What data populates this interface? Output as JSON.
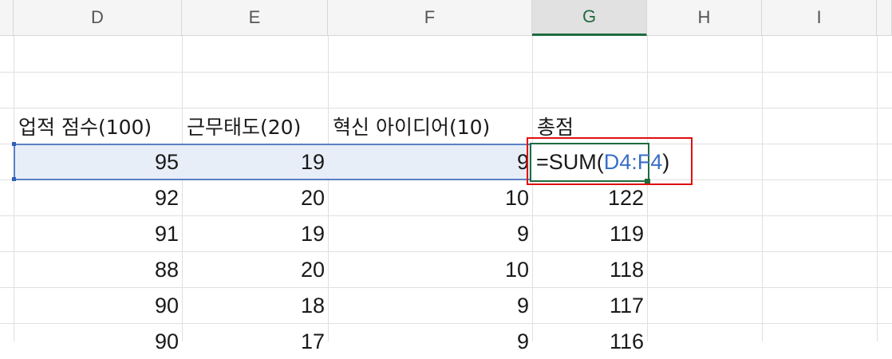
{
  "columns": [
    "D",
    "E",
    "F",
    "G",
    "H",
    "I"
  ],
  "active_column": "G",
  "headers": {
    "d": "업적 점수(100)",
    "e": "근무태도(20)",
    "f": "혁신 아이디어(10)",
    "g": "총점"
  },
  "edit_formula": {
    "prefix": "=SUM(",
    "ref": "D4:F4",
    "suffix": ")"
  },
  "rows": [
    {
      "d": "95",
      "e": "19",
      "f": "9",
      "g": ""
    },
    {
      "d": "92",
      "e": "20",
      "f": "10",
      "g": "122"
    },
    {
      "d": "91",
      "e": "19",
      "f": "9",
      "g": "119"
    },
    {
      "d": "88",
      "e": "20",
      "f": "10",
      "g": "118"
    },
    {
      "d": "90",
      "e": "18",
      "f": "9",
      "g": "117"
    },
    {
      "d": "90",
      "e": "17",
      "f": "9",
      "g": "116"
    }
  ],
  "colors": {
    "accent_green": "#1e6c3f",
    "reference_blue": "#3a6fc8",
    "annotation_red": "#e01010"
  }
}
